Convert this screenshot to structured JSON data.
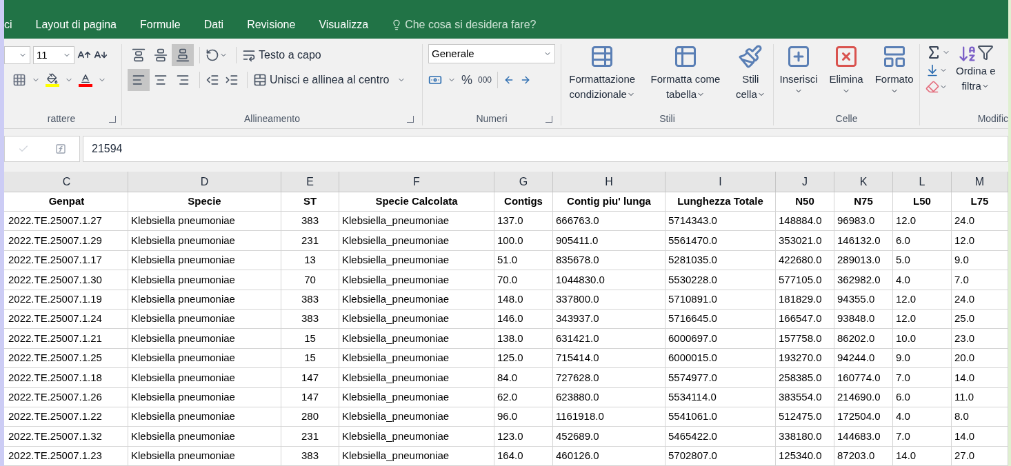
{
  "tabs": [
    {
      "label": "ci",
      "selected": false
    },
    {
      "label": "Layout di pagina",
      "selected": false
    },
    {
      "label": "Formule",
      "selected": false
    },
    {
      "label": "Dati",
      "selected": false
    },
    {
      "label": "Revisione",
      "selected": false
    },
    {
      "label": "Visualizza",
      "selected": false
    }
  ],
  "tell_me": {
    "placeholder": "Che cosa si desidera fare?"
  },
  "ribbon": {
    "font": {
      "size": "11",
      "label": "rattere"
    },
    "alignment": {
      "vertical": [
        {
          "kind": "top",
          "pressed": false
        },
        {
          "kind": "middle",
          "pressed": false
        },
        {
          "kind": "bottom",
          "pressed": true
        }
      ],
      "horizontal": [
        {
          "kind": "left",
          "pressed": true
        },
        {
          "kind": "center",
          "pressed": false
        },
        {
          "kind": "right",
          "pressed": false
        }
      ],
      "wrap": "Testo a capo",
      "merge": "Unisci e allinea al centro",
      "label": "Allineamento"
    },
    "number": {
      "format": "Generale",
      "percent": "%",
      "thousands": "000",
      "label": "Numeri"
    },
    "styles": {
      "buttons": [
        {
          "kind": "conditional",
          "lines": [
            "Formattazione",
            "condizionale"
          ]
        },
        {
          "kind": "table",
          "lines": [
            "Formatta come",
            "tabella"
          ]
        },
        {
          "kind": "cell",
          "lines": [
            "Stili",
            "cella"
          ]
        }
      ],
      "label": "Stili"
    },
    "cells": {
      "buttons": [
        {
          "kind": "insert",
          "label": "Inserisci"
        },
        {
          "kind": "delete",
          "label": "Elimina"
        },
        {
          "kind": "format",
          "label": "Formato"
        }
      ],
      "label": "Celle"
    },
    "editing": {
      "sort": [
        "Ordina e",
        "filtra"
      ],
      "label": "Modific"
    }
  },
  "formula_bar": {
    "value": "21594"
  },
  "sheet": {
    "columns": [
      "C",
      "D",
      "E",
      "F",
      "G",
      "H",
      "I",
      "J",
      "K",
      "L",
      "M"
    ],
    "header": [
      "Genpat",
      "Specie",
      "ST",
      "Specie Calcolata",
      "Contigs",
      "Contig piu' lunga",
      "Lunghezza Totale",
      "N50",
      "N75",
      "L50",
      "L75"
    ],
    "rows": [
      [
        "2022.TE.25007.1.27",
        "Klebsiella pneumoniae",
        "383",
        "Klebsiella_pneumoniae",
        "137.0",
        "666763.0",
        "5714343.0",
        "148884.0",
        "96983.0",
        "12.0",
        "24.0"
      ],
      [
        "2022.TE.25007.1.29",
        "Klebsiella pneumoniae",
        "231",
        "Klebsiella_pneumoniae",
        "100.0",
        "905411.0",
        "5561470.0",
        "353021.0",
        "146132.0",
        "6.0",
        "12.0"
      ],
      [
        "2022.TE.25007.1.17",
        "Klebsiella pneumoniae",
        "13",
        "Klebsiella_pneumoniae",
        "51.0",
        "835678.0",
        "5281035.0",
        "422680.0",
        "289013.0",
        "5.0",
        "9.0"
      ],
      [
        "2022.TE.25007.1.30",
        "Klebsiella pneumoniae",
        "70",
        "Klebsiella_pneumoniae",
        "70.0",
        "1044830.0",
        "5530228.0",
        "577105.0",
        "362982.0",
        "4.0",
        "7.0"
      ],
      [
        "2022.TE.25007.1.19",
        "Klebsiella pneumoniae",
        "383",
        "Klebsiella_pneumoniae",
        "148.0",
        "337800.0",
        "5710891.0",
        "181829.0",
        "94355.0",
        "12.0",
        "24.0"
      ],
      [
        "2022.TE.25007.1.24",
        "Klebsiella pneumoniae",
        "383",
        "Klebsiella_pneumoniae",
        "146.0",
        "343937.0",
        "5716645.0",
        "166547.0",
        "93848.0",
        "12.0",
        "25.0"
      ],
      [
        "2022.TE.25007.1.21",
        "Klebsiella pneumoniae",
        "15",
        "Klebsiella_pneumoniae",
        "138.0",
        "631421.0",
        "6000697.0",
        "157758.0",
        "86202.0",
        "10.0",
        "23.0"
      ],
      [
        "2022.TE.25007.1.25",
        "Klebsiella pneumoniae",
        "15",
        "Klebsiella_pneumoniae",
        "125.0",
        "715414.0",
        "6000015.0",
        "193270.0",
        "94244.0",
        "9.0",
        "20.0"
      ],
      [
        "2022.TE.25007.1.18",
        "Klebsiella pneumoniae",
        "147",
        "Klebsiella_pneumoniae",
        "84.0",
        "727628.0",
        "5574977.0",
        "258385.0",
        "160774.0",
        "7.0",
        "14.0"
      ],
      [
        "2022.TE.25007.1.26",
        "Klebsiella pneumoniae",
        "147",
        "Klebsiella_pneumoniae",
        "62.0",
        "623880.0",
        "5534114.0",
        "383554.0",
        "214690.0",
        "6.0",
        "11.0"
      ],
      [
        "2022.TE.25007.1.22",
        "Klebsiella pneumoniae",
        "280",
        "Klebsiella_pneumoniae",
        "96.0",
        "1161918.0",
        "5541061.0",
        "512475.0",
        "172504.0",
        "4.0",
        "8.0"
      ],
      [
        "2022.TE.25007.1.32",
        "Klebsiella pneumoniae",
        "231",
        "Klebsiella_pneumoniae",
        "123.0",
        "452689.0",
        "5465422.0",
        "338180.0",
        "144683.0",
        "7.0",
        "14.0"
      ],
      [
        "2022.TE.25007.1.23",
        "Klebsiella pneumoniae",
        "383",
        "Klebsiella_pneumoniae",
        "164.0",
        "460126.0",
        "5702807.0",
        "125340.0",
        "87203.0",
        "14.0",
        "27.0"
      ]
    ]
  }
}
